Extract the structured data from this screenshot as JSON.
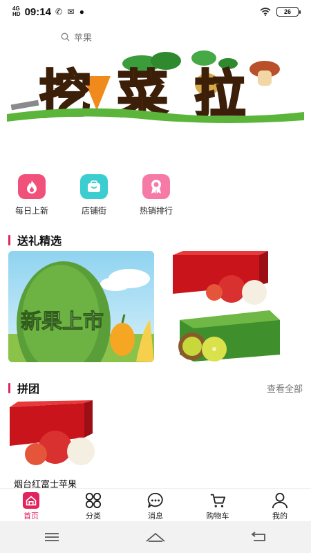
{
  "status_bar": {
    "network": "4G",
    "network_sub": "HD",
    "time": "09:14",
    "notif_icons": "✆ ✉ ●",
    "battery": "26"
  },
  "search": {
    "placeholder": "苹果"
  },
  "banner": {
    "brand_text": "挖菜拉"
  },
  "quick_nav": [
    {
      "label": "每日上新",
      "icon": "flame-icon",
      "color": "#f0507a"
    },
    {
      "label": "店铺街",
      "icon": "shop-bag-icon",
      "color": "#3ccdd0"
    },
    {
      "label": "热销排行",
      "icon": "ribbon-badge-icon",
      "color": "#f57aa5"
    }
  ],
  "gift_section": {
    "title": "送礼精选",
    "promo_text": "新果上市"
  },
  "group_section": {
    "title": "拼团",
    "view_all": "查看全部",
    "products": [
      {
        "name": "烟台红富士苹果"
      }
    ]
  },
  "tab_bar": {
    "items": [
      {
        "label": "首页",
        "icon": "home-icon",
        "active": true
      },
      {
        "label": "分类",
        "icon": "grid-icon",
        "active": false
      },
      {
        "label": "消息",
        "icon": "message-icon",
        "active": false
      },
      {
        "label": "购物车",
        "icon": "cart-icon",
        "active": false
      },
      {
        "label": "我的",
        "icon": "user-icon",
        "active": false
      }
    ]
  },
  "colors": {
    "accent": "#e0245e",
    "text": "#222222",
    "muted": "#777777"
  }
}
